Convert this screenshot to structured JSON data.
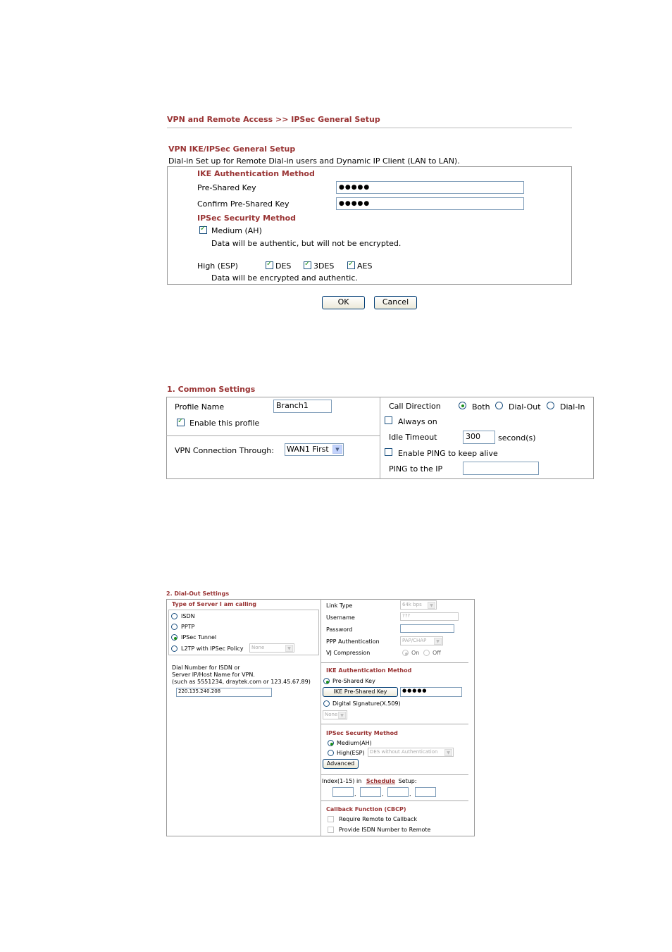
{
  "s1": {
    "breadcrumb": "VPN and Remote Access >> IPSec General Setup",
    "title": "VPN IKE/IPSec General Setup",
    "description": "Dial-in Set up for Remote Dial-in users and Dynamic IP Client (LAN to LAN).",
    "ike_heading": "IKE Authentication Method",
    "psk_label": "Pre-Shared Key",
    "psk_value": "●●●●●",
    "confirm_label": "Confirm Pre-Shared Key",
    "confirm_value": "●●●●●",
    "ipsec_heading": "IPSec Security Method",
    "medium_label": "Medium (AH)",
    "medium_desc": "Data will be authentic, but will not be encrypted.",
    "high_label": "High (ESP)",
    "des_label": "DES",
    "tdes_label": "3DES",
    "aes_label": "AES",
    "high_desc": "Data will be encrypted and authentic.",
    "ok_label": "OK",
    "cancel_label": "Cancel"
  },
  "s2": {
    "heading": "1. Common Settings",
    "profile_name_label": "Profile Name",
    "profile_name_value": "Branch1",
    "enable_label": "Enable this profile",
    "vpn_through_label": "VPN Connection Through:",
    "vpn_through_value": "WAN1 First",
    "call_direction_label": "Call Direction",
    "both_label": "Both",
    "dialout_label": "Dial-Out",
    "dialin_label": "Dial-In",
    "always_on_label": "Always on",
    "idle_label": "Idle Timeout",
    "idle_value": "300",
    "seconds_label": "second(s)",
    "ping_enable_label": "Enable PING to keep alive",
    "ping_ip_label": "PING to the IP",
    "ping_ip_value": ""
  },
  "s3": {
    "heading": "2. Dial-Out Settings",
    "server_type_heading": "Type of Server I am calling",
    "isdn_label": "ISDN",
    "pptp_label": "PPTP",
    "ipsec_tunnel_label": "IPSec Tunnel",
    "l2tp_label": "L2TP with IPSec Policy",
    "l2tp_select": "None",
    "dial_desc_1": "Dial Number for ISDN or",
    "dial_desc_2": "Server IP/Host Name for VPN.",
    "dial_desc_3": "(such as 5551234, draytek.com or 123.45.67.89)",
    "dial_value": "220.135.240.208",
    "link_type_label": "Link Type",
    "link_type_value": "64k bps",
    "username_label": "Username",
    "username_value": "???",
    "password_label": "Password",
    "password_value": "",
    "ppp_auth_label": "PPP Authentication",
    "ppp_auth_value": "PAP/CHAP",
    "vj_label": "VJ Compression",
    "vj_on": "On",
    "vj_off": "Off",
    "ike_heading": "IKE Authentication Method",
    "psk_label": "Pre-Shared Key",
    "psk_button": "IKE Pre-Shared Key",
    "psk_value": "●●●●●",
    "digsig_label": "Digital Signature(X.509)",
    "digsig_select": "None",
    "ipsec_heading": "IPSec Security Method",
    "medium_label": "Medium(AH)",
    "high_label": "High(ESP)",
    "high_select": "DES without Authentication",
    "advanced_label": "Advanced",
    "index_prefix": "Index(1-15) in",
    "schedule_link": "Schedule",
    "index_suffix": "Setup:",
    "comma": ",",
    "callback_heading": "Callback Function (CBCP)",
    "require_callback_label": "Require Remote to Callback",
    "provide_isdn_label": "Provide ISDN Number to Remote"
  }
}
